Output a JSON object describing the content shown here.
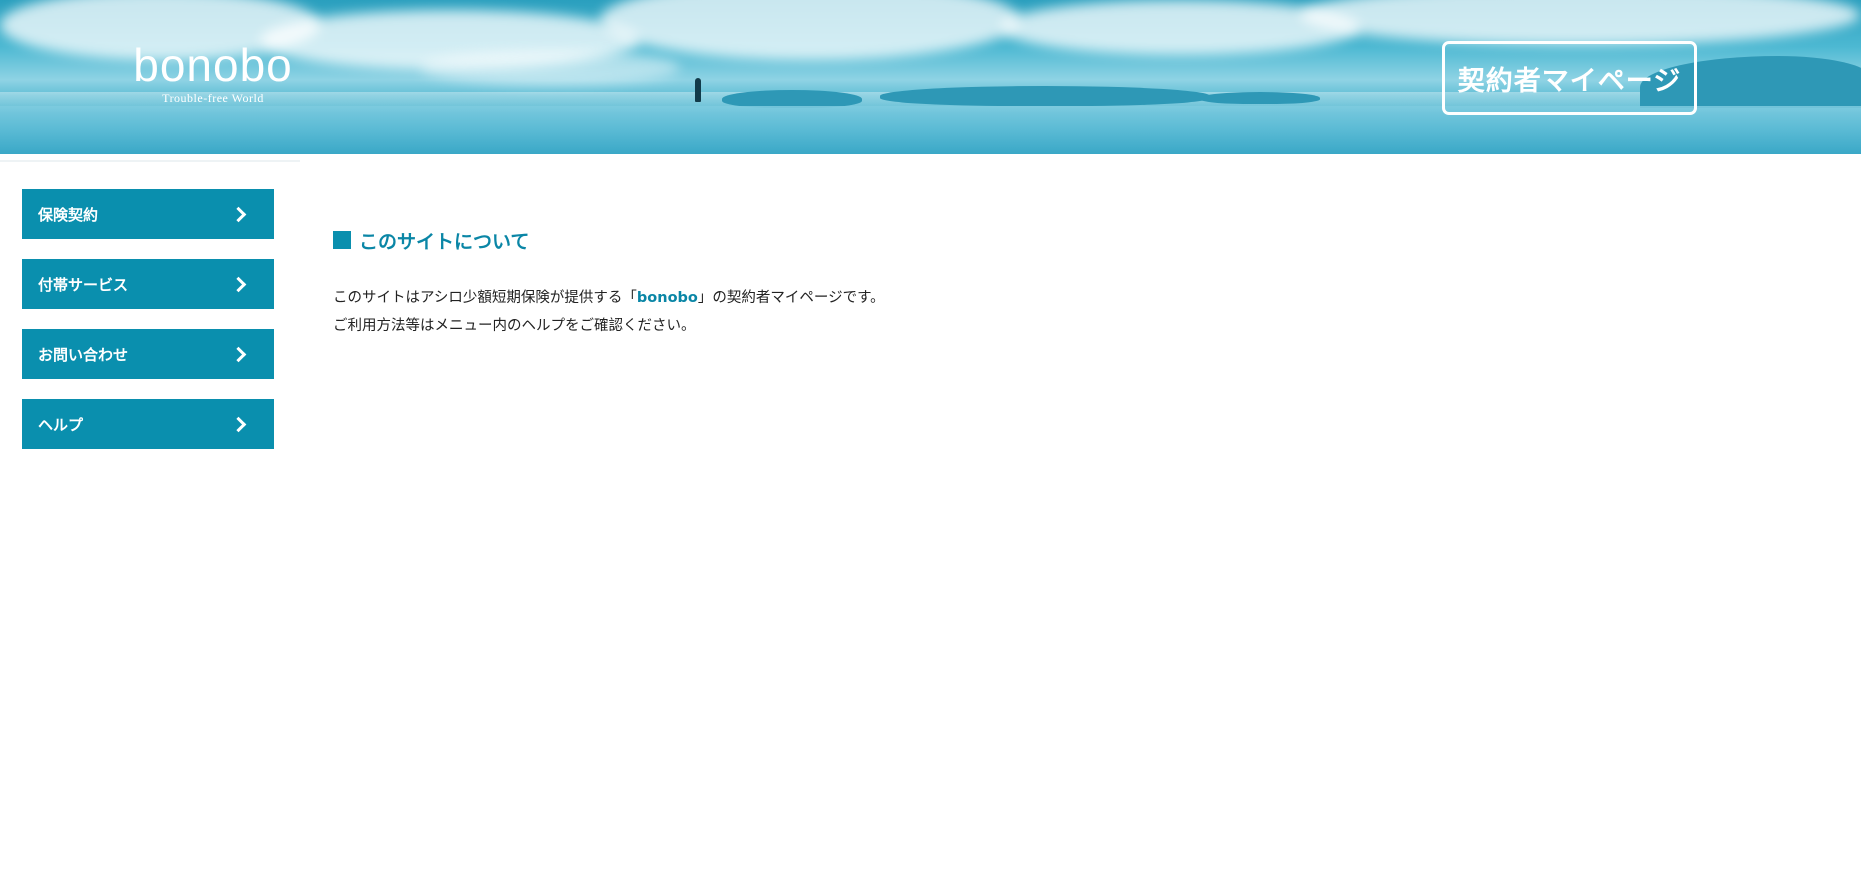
{
  "header": {
    "logo_text": "bonobo",
    "logo_tagline": "Trouble-free World",
    "mypage_label": "契約者マイページ"
  },
  "sidebar": {
    "items": [
      {
        "label": "保険契約"
      },
      {
        "label": "付帯サービス"
      },
      {
        "label": "お問い合わせ"
      },
      {
        "label": "ヘルプ"
      }
    ]
  },
  "main": {
    "section_title": "このサイトについて",
    "line1_before": "このサイトはアシロ少額短期保険が提供する「",
    "line1_brand": "bonobo",
    "line1_after": "」の契約者マイページです。",
    "line2": "ご利用方法等はメニュー内のヘルプをご確認ください。"
  },
  "colors": {
    "accent": "#0a8fae",
    "title_text": "#0a86a6",
    "header_sky": "#4cb8d2"
  },
  "icons": {
    "nav_chevron": "chevron-right-icon",
    "title_marker": "square-marker-icon"
  }
}
